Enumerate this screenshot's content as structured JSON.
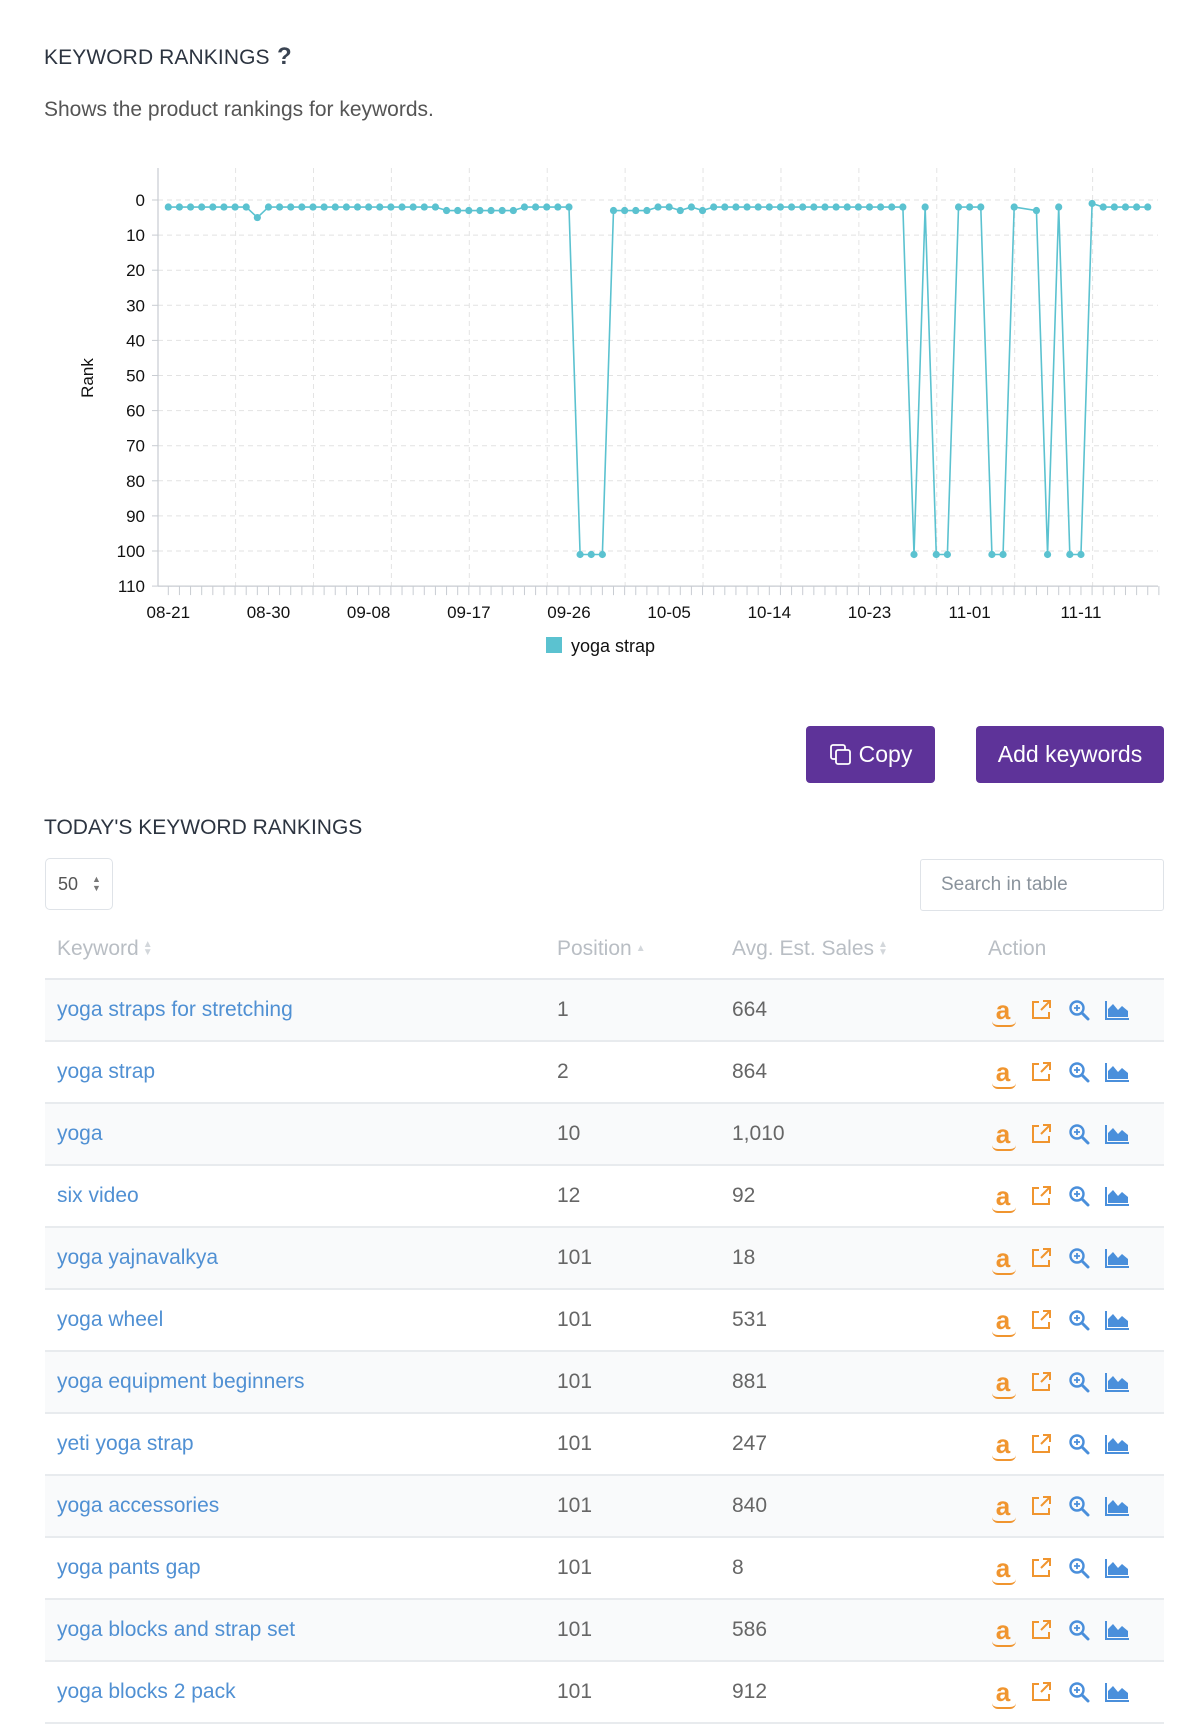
{
  "header": {
    "title": "KEYWORD RANKINGS",
    "help_icon": "question-mark-icon",
    "help_glyph": "?",
    "subtitle": "Shows the product rankings for keywords."
  },
  "chart_data": {
    "type": "line",
    "title": "",
    "xlabel": "",
    "ylabel": "Rank",
    "y_inverted": true,
    "ylim": [
      0,
      110
    ],
    "yticks": [
      0,
      10,
      20,
      30,
      40,
      50,
      60,
      70,
      80,
      90,
      100,
      110
    ],
    "x_start": "08-21",
    "x_end_day_index": 89,
    "xticks": [
      {
        "label": "08-21",
        "day": 0
      },
      {
        "label": "08-30",
        "day": 9
      },
      {
        "label": "09-08",
        "day": 18
      },
      {
        "label": "09-17",
        "day": 27
      },
      {
        "label": "09-26",
        "day": 36
      },
      {
        "label": "10-05",
        "day": 45
      },
      {
        "label": "10-14",
        "day": 54
      },
      {
        "label": "10-23",
        "day": 63
      },
      {
        "label": "11-01",
        "day": 72
      },
      {
        "label": "11-11",
        "day": 82
      }
    ],
    "grid": true,
    "legend_position": "bottom-center",
    "series": [
      {
        "name": "yoga strap",
        "color": "#5bc2d0",
        "points": [
          [
            0,
            2
          ],
          [
            1,
            2
          ],
          [
            2,
            2
          ],
          [
            3,
            2
          ],
          [
            4,
            2
          ],
          [
            5,
            2
          ],
          [
            6,
            2
          ],
          [
            7,
            2
          ],
          [
            8,
            5
          ],
          [
            9,
            2
          ],
          [
            10,
            2
          ],
          [
            11,
            2
          ],
          [
            12,
            2
          ],
          [
            13,
            2
          ],
          [
            14,
            2
          ],
          [
            15,
            2
          ],
          [
            16,
            2
          ],
          [
            17,
            2
          ],
          [
            18,
            2
          ],
          [
            19,
            2
          ],
          [
            20,
            2
          ],
          [
            21,
            2
          ],
          [
            22,
            2
          ],
          [
            23,
            2
          ],
          [
            24,
            2
          ],
          [
            25,
            3
          ],
          [
            26,
            3
          ],
          [
            27,
            3
          ],
          [
            28,
            3
          ],
          [
            29,
            3
          ],
          [
            30,
            3
          ],
          [
            31,
            3
          ],
          [
            32,
            2
          ],
          [
            33,
            2
          ],
          [
            34,
            2
          ],
          [
            35,
            2
          ],
          [
            36,
            2
          ],
          [
            37,
            101
          ],
          [
            38,
            101
          ],
          [
            39,
            101
          ],
          [
            40,
            3
          ],
          [
            41,
            3
          ],
          [
            42,
            3
          ],
          [
            43,
            3
          ],
          [
            44,
            2
          ],
          [
            45,
            2
          ],
          [
            46,
            3
          ],
          [
            47,
            2
          ],
          [
            48,
            3
          ],
          [
            49,
            2
          ],
          [
            50,
            2
          ],
          [
            51,
            2
          ],
          [
            52,
            2
          ],
          [
            53,
            2
          ],
          [
            54,
            2
          ],
          [
            55,
            2
          ],
          [
            56,
            2
          ],
          [
            57,
            2
          ],
          [
            58,
            2
          ],
          [
            59,
            2
          ],
          [
            60,
            2
          ],
          [
            61,
            2
          ],
          [
            62,
            2
          ],
          [
            63,
            2
          ],
          [
            64,
            2
          ],
          [
            65,
            2
          ],
          [
            66,
            2
          ],
          [
            67,
            101
          ],
          [
            68,
            2
          ],
          [
            69,
            101
          ],
          [
            70,
            101
          ],
          [
            71,
            2
          ],
          [
            72,
            2
          ],
          [
            73,
            2
          ],
          [
            74,
            101
          ],
          [
            75,
            101
          ],
          [
            76,
            2
          ],
          [
            78,
            3
          ],
          [
            79,
            101
          ],
          [
            80,
            2
          ],
          [
            81,
            101
          ],
          [
            82,
            101
          ],
          [
            83,
            1
          ],
          [
            84,
            2
          ],
          [
            85,
            2
          ],
          [
            86,
            2
          ],
          [
            87,
            2
          ],
          [
            88,
            2
          ]
        ]
      }
    ]
  },
  "actions": {
    "copy_label": "Copy",
    "copy_icon": "copy-icon",
    "add_keywords_label": "Add keywords",
    "button_color": "#5e3399"
  },
  "table_section": {
    "title": "TODAY'S KEYWORD RANKINGS",
    "page_size": "50",
    "search_placeholder": "Search in table",
    "columns": [
      "Keyword",
      "Position",
      "Avg. Est. Sales",
      "Action"
    ],
    "sort": {
      "column": "Position",
      "direction": "ascending"
    },
    "action_icons": [
      "amazon-icon",
      "external-link-icon",
      "zoom-in-icon",
      "area-chart-icon"
    ],
    "rows": [
      {
        "keyword": "yoga straps for stretching",
        "position": "1",
        "sales": "664"
      },
      {
        "keyword": "yoga strap",
        "position": "2",
        "sales": "864"
      },
      {
        "keyword": "yoga",
        "position": "10",
        "sales": "1,010"
      },
      {
        "keyword": "six video",
        "position": "12",
        "sales": "92"
      },
      {
        "keyword": "yoga yajnavalkya",
        "position": "101",
        "sales": "18"
      },
      {
        "keyword": "yoga wheel",
        "position": "101",
        "sales": "531"
      },
      {
        "keyword": "yoga equipment beginners",
        "position": "101",
        "sales": "881"
      },
      {
        "keyword": "yeti yoga strap",
        "position": "101",
        "sales": "247"
      },
      {
        "keyword": "yoga accessories",
        "position": "101",
        "sales": "840"
      },
      {
        "keyword": "yoga pants gap",
        "position": "101",
        "sales": "8"
      },
      {
        "keyword": "yoga blocks and strap set",
        "position": "101",
        "sales": "586"
      },
      {
        "keyword": "yoga blocks 2 pack",
        "position": "101",
        "sales": "912"
      }
    ]
  }
}
